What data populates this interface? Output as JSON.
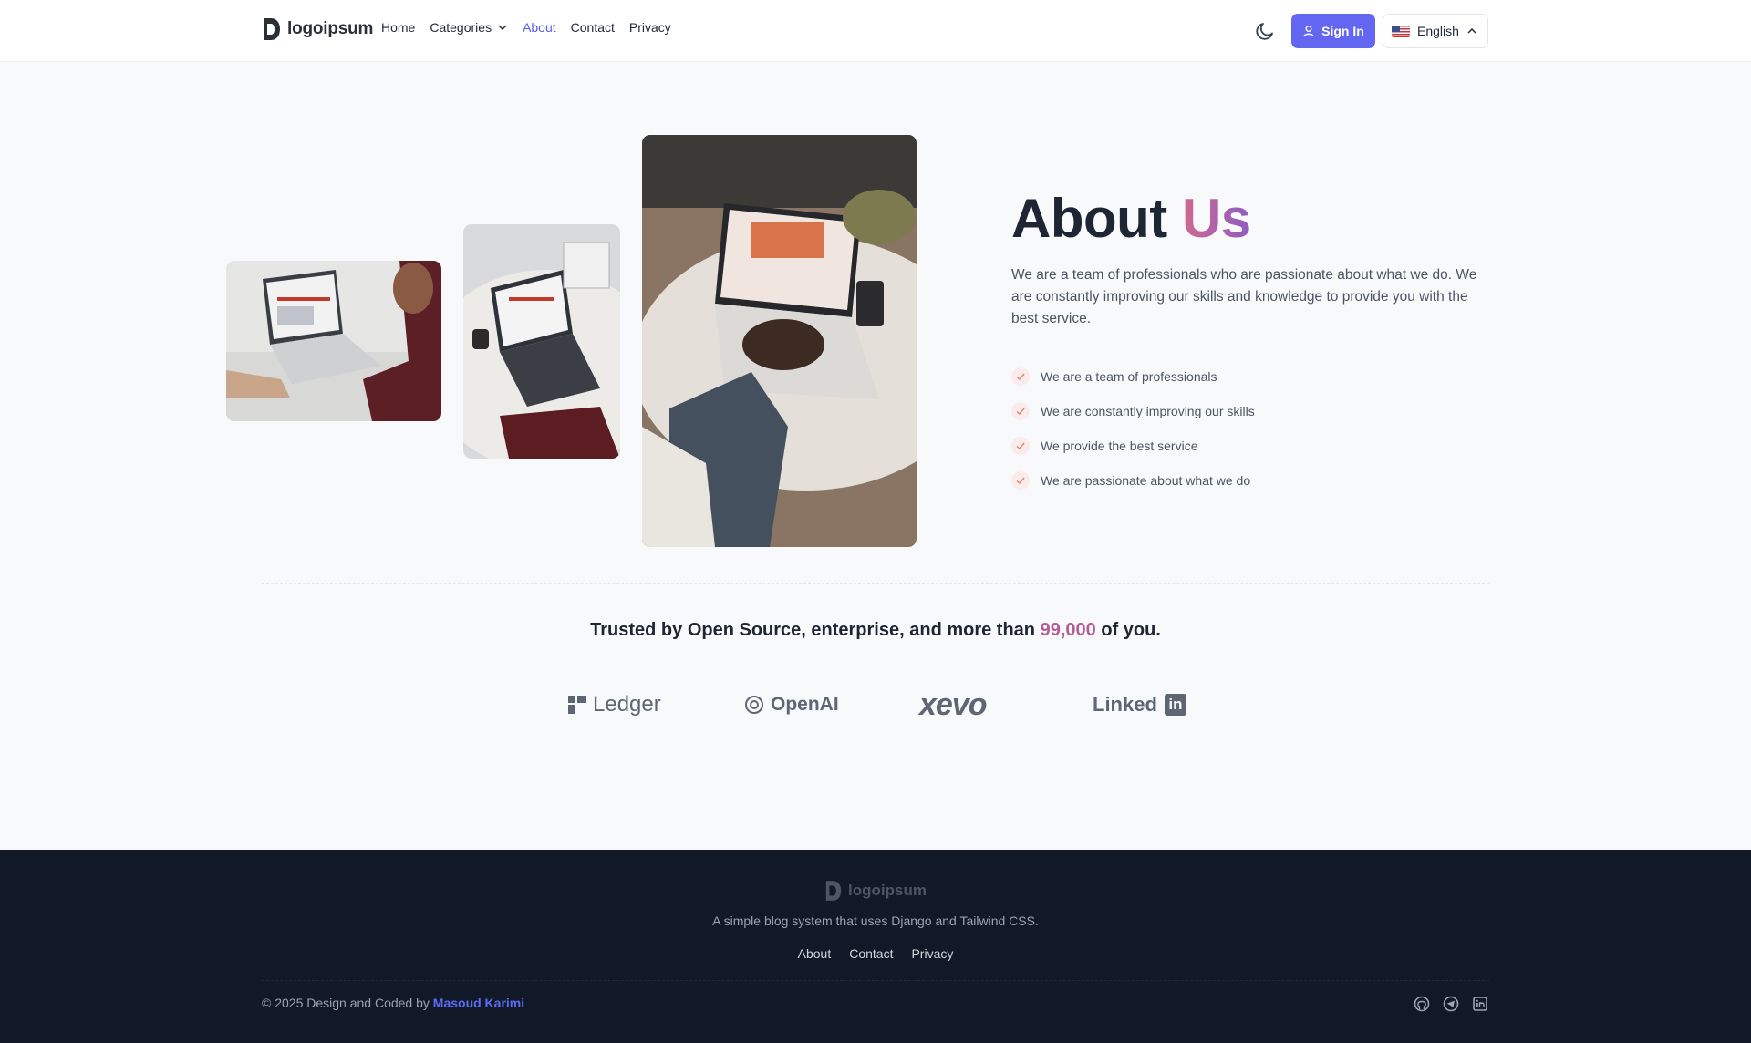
{
  "header": {
    "logo_text": "logoipsum",
    "nav": {
      "home": "Home",
      "categories": "Categories",
      "about": "About",
      "contact": "Contact",
      "privacy": "Privacy"
    },
    "signin_label": "Sign In",
    "language": "English",
    "theme_icon": "moon-icon"
  },
  "about": {
    "title_main": "About",
    "title_accent": "Us",
    "description": "We are a team of professionals who are passionate about what we do. We are constantly improving our skills and knowledge to provide you with the best service.",
    "features": [
      "We are a team of professionals",
      "We are constantly improving our skills",
      "We provide the best service",
      "We are passionate about what we do"
    ]
  },
  "trusted": {
    "prefix": "Trusted by Open Source, enterprise, and more than",
    "number": "99,000",
    "suffix": "of you."
  },
  "partners": {
    "ledger": "Ledger",
    "openai": "OpenAI",
    "xevo": "xevo",
    "linkedin": "Linked",
    "linkedin_box": "in"
  },
  "footer": {
    "logo_text": "logoipsum",
    "tagline": "A simple blog system that uses Django and Tailwind CSS.",
    "links": {
      "about": "About",
      "contact": "Contact",
      "privacy": "Privacy"
    },
    "copyright": "© 2025 Design and Coded by",
    "author": "Masoud Karimi",
    "social_icons": [
      "github-icon",
      "telegram-icon",
      "linkedin-icon"
    ]
  },
  "colors": {
    "primary": "#6366f1",
    "footer_bg": "#111827",
    "accent_gradient_start": "#d06a8c",
    "accent_gradient_end": "#8e5cc4"
  }
}
